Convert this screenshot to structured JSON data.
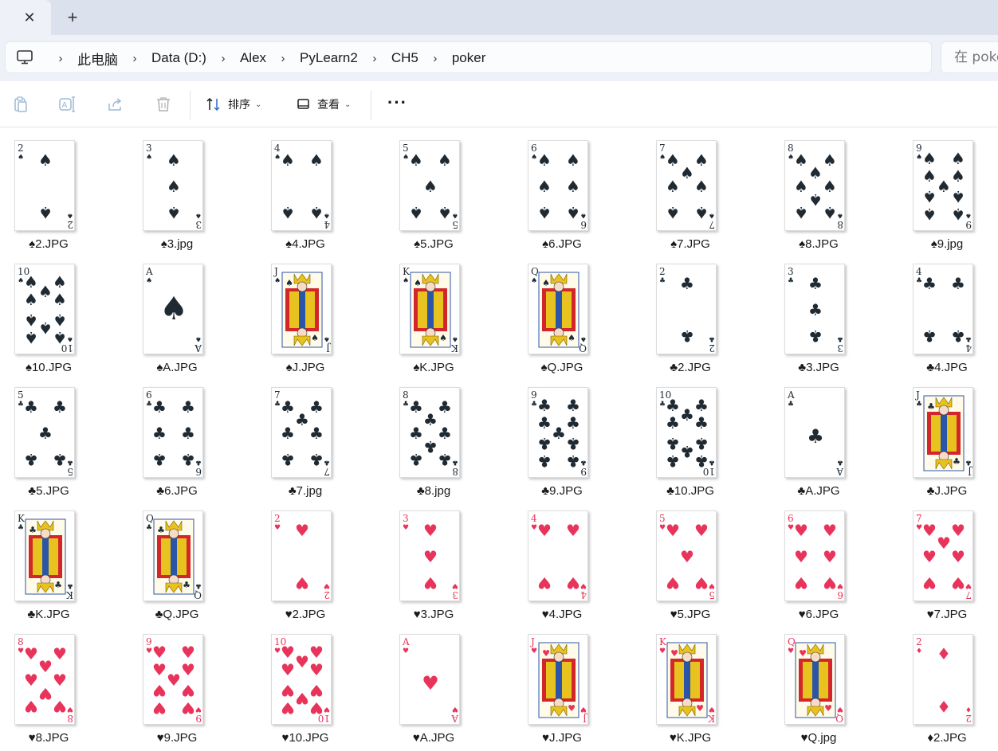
{
  "tabbar": {
    "close_glyph": "✕",
    "new_tab_glyph": "+"
  },
  "address": {
    "crumbs": [
      "此电脑",
      "Data (D:)",
      "Alex",
      "PyLearn2",
      "CH5",
      "poker"
    ],
    "search_placeholder": "在 poker"
  },
  "toolbar": {
    "sort_label": "排序",
    "view_label": "查看",
    "more_glyph": "···"
  },
  "files": [
    {
      "suit": "spade",
      "rank": "2",
      "name": "♠2.JPG"
    },
    {
      "suit": "spade",
      "rank": "3",
      "name": "♠3.jpg"
    },
    {
      "suit": "spade",
      "rank": "4",
      "name": "♠4.JPG"
    },
    {
      "suit": "spade",
      "rank": "5",
      "name": "♠5.JPG"
    },
    {
      "suit": "spade",
      "rank": "6",
      "name": "♠6.JPG"
    },
    {
      "suit": "spade",
      "rank": "7",
      "name": "♠7.JPG"
    },
    {
      "suit": "spade",
      "rank": "8",
      "name": "♠8.JPG"
    },
    {
      "suit": "spade",
      "rank": "9",
      "name": "♠9.jpg"
    },
    {
      "suit": "spade",
      "rank": "10",
      "name": "♠10.JPG"
    },
    {
      "suit": "spade",
      "rank": "A",
      "name": "♠A.JPG"
    },
    {
      "suit": "spade",
      "rank": "J",
      "name": "♠J.JPG"
    },
    {
      "suit": "spade",
      "rank": "K",
      "name": "♠K.JPG"
    },
    {
      "suit": "spade",
      "rank": "Q",
      "name": "♠Q.JPG"
    },
    {
      "suit": "club",
      "rank": "2",
      "name": "♣2.JPG"
    },
    {
      "suit": "club",
      "rank": "3",
      "name": "♣3.JPG"
    },
    {
      "suit": "club",
      "rank": "4",
      "name": "♣4.JPG"
    },
    {
      "suit": "club",
      "rank": "5",
      "name": "♣5.JPG"
    },
    {
      "suit": "club",
      "rank": "6",
      "name": "♣6.JPG"
    },
    {
      "suit": "club",
      "rank": "7",
      "name": "♣7.jpg"
    },
    {
      "suit": "club",
      "rank": "8",
      "name": "♣8.jpg"
    },
    {
      "suit": "club",
      "rank": "9",
      "name": "♣9.JPG"
    },
    {
      "suit": "club",
      "rank": "10",
      "name": "♣10.JPG"
    },
    {
      "suit": "club",
      "rank": "A",
      "name": "♣A.JPG"
    },
    {
      "suit": "club",
      "rank": "J",
      "name": "♣J.JPG"
    },
    {
      "suit": "club",
      "rank": "K",
      "name": "♣K.JPG"
    },
    {
      "suit": "club",
      "rank": "Q",
      "name": "♣Q.JPG"
    },
    {
      "suit": "heart",
      "rank": "2",
      "name": "♥2.JPG"
    },
    {
      "suit": "heart",
      "rank": "3",
      "name": "♥3.JPG"
    },
    {
      "suit": "heart",
      "rank": "4",
      "name": "♥4.JPG"
    },
    {
      "suit": "heart",
      "rank": "5",
      "name": "♥5.JPG"
    },
    {
      "suit": "heart",
      "rank": "6",
      "name": "♥6.JPG"
    },
    {
      "suit": "heart",
      "rank": "7",
      "name": "♥7.JPG"
    },
    {
      "suit": "heart",
      "rank": "8",
      "name": "♥8.JPG"
    },
    {
      "suit": "heart",
      "rank": "9",
      "name": "♥9.JPG"
    },
    {
      "suit": "heart",
      "rank": "10",
      "name": "♥10.JPG"
    },
    {
      "suit": "heart",
      "rank": "A",
      "name": "♥A.JPG"
    },
    {
      "suit": "heart",
      "rank": "J",
      "name": "♥J.JPG"
    },
    {
      "suit": "heart",
      "rank": "K",
      "name": "♥K.JPG"
    },
    {
      "suit": "heart",
      "rank": "Q",
      "name": "♥Q.jpg"
    },
    {
      "suit": "diamond",
      "rank": "2",
      "name": "♦2.JPG"
    }
  ],
  "colors": {
    "black_suit": "#1f2a33",
    "red_suit": "#e8345a",
    "court_gold": "#e8c21e",
    "court_red": "#d3262b",
    "court_blue": "#2b56a8"
  }
}
